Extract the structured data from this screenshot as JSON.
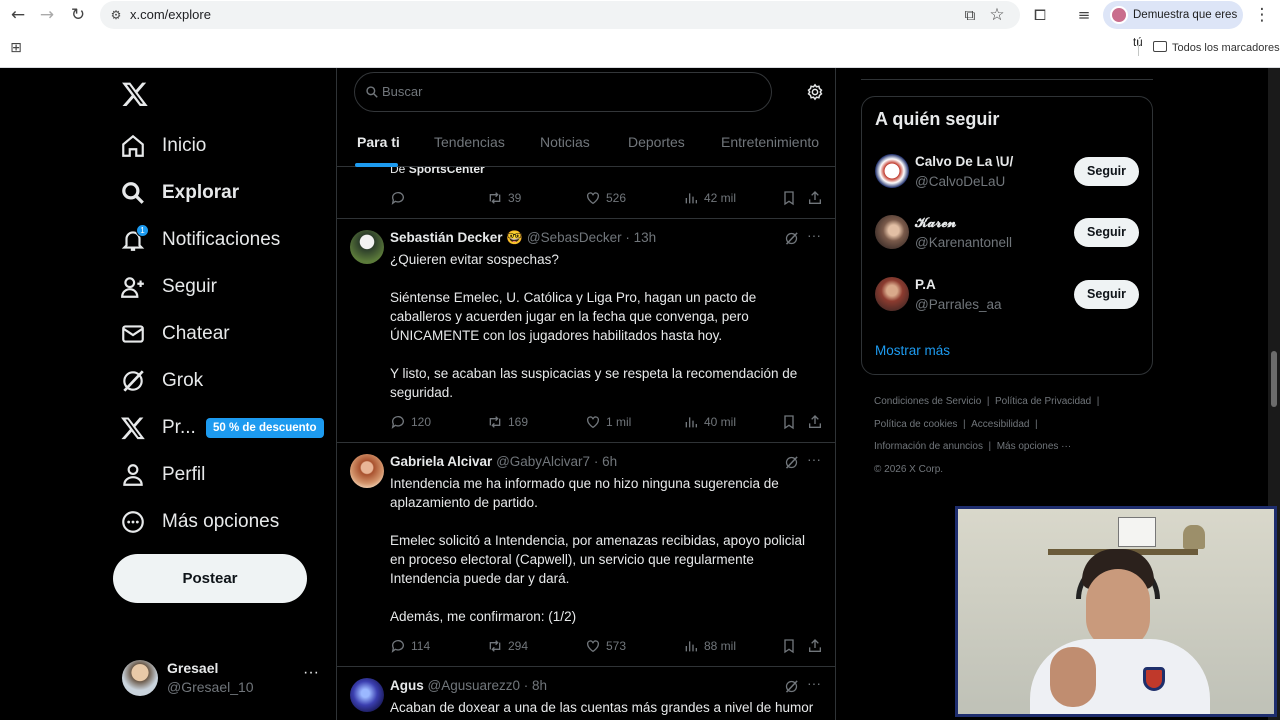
{
  "browser": {
    "url": "x.com/explore",
    "profile_label": "Demuestra que eres tú",
    "bookmarks_label": "Todos los marcadores"
  },
  "sidebar": {
    "items": [
      {
        "label": "Inicio",
        "icon": "home-icon"
      },
      {
        "label": "Explorar",
        "icon": "search-icon",
        "active": true
      },
      {
        "label": "Notificaciones",
        "icon": "bell-icon"
      },
      {
        "label": "Seguir",
        "icon": "add-person-icon"
      },
      {
        "label": "Chatear",
        "icon": "mail-icon"
      },
      {
        "label": "Grok",
        "icon": "grok-icon"
      },
      {
        "label": "Pr...",
        "icon": "x-logo-icon"
      },
      {
        "label": "Perfil",
        "icon": "person-icon"
      },
      {
        "label": "Más opciones",
        "icon": "more-circle-icon"
      }
    ],
    "notif_count": "1",
    "premium_badge": "50 % de descuento",
    "post_button": "Postear",
    "account": {
      "name": "Gresael",
      "handle": "@Gresael_10"
    }
  },
  "main": {
    "search_placeholder": "Buscar",
    "tabs": [
      "Para ti",
      "Tendencias",
      "Noticias",
      "Deportes",
      "Entretenimiento"
    ],
    "partial_tweet": {
      "text_prefix": "De ",
      "text_bold": "SportsCenter",
      "replies": "",
      "reposts": "39",
      "likes": "526",
      "views": "42 mil"
    },
    "tweets": [
      {
        "name": "Sebastián Decker",
        "emoji": "🤓",
        "handle": "@SebasDecker",
        "time": "· 13h",
        "text": "¿Quieren evitar sospechas?\n\nSiéntense Emelec, U. Católica y Liga Pro, hagan un pacto de caballeros y acuerden jugar en la fecha que convenga, pero ÚNICAMENTE con los jugadores habilitados hasta hoy.\n\nY listo, se acaban las suspicacias y se respeta la recomendación de seguridad.",
        "replies": "120",
        "reposts": "169",
        "likes": "1 mil",
        "views": "40 mil"
      },
      {
        "name": "Gabriela Alcivar",
        "emoji": "",
        "handle": "@GabyAlcivar7",
        "time": "· 6h",
        "text": "Intendencia me ha informado que no hizo ninguna sugerencia de aplazamiento de partido.\n\nEmelec solicitó a Intendencia, por amenazas recibidas, apoyo policial en proceso electoral (Capwell), un servicio que regularmente Intendencia puede dar y dará.\n\nAdemás, me confirmaron: (1/2)",
        "replies": "114",
        "reposts": "294",
        "likes": "573",
        "views": "88 mil"
      },
      {
        "name": "Agus",
        "emoji": "",
        "handle": "@Agusuarezz0",
        "time": "· 8h",
        "text": "Acaban de doxear a una de las cuentas más grandes a nivel de humor negro",
        "replies": "",
        "reposts": "",
        "likes": "",
        "views": ""
      }
    ]
  },
  "right": {
    "who_to_follow_title": "A quién seguir",
    "suggestions": [
      {
        "name": "Calvo De La \\U/",
        "handle": "@CalvoDeLaU",
        "button": "Seguir"
      },
      {
        "name": "𝓚𝓪𝓻𝓮𝓷",
        "handle": "@Karenantonell",
        "button": "Seguir"
      },
      {
        "name": "P.A",
        "handle": "@Parrales_aa",
        "button": "Seguir"
      }
    ],
    "show_more": "Mostrar más",
    "footer": {
      "line1a": "Condiciones de Servicio",
      "line1b": "Política de Privacidad",
      "line2a": "Política de cookies",
      "line2b": "Accesibilidad",
      "line3a": "Información de anuncios",
      "line3b": "Más opciones ···",
      "copyright": "© 2026 X Corp."
    }
  },
  "colors": {
    "accent": "#1d9bf0",
    "background": "#000000",
    "text": "#e7e9ea",
    "muted": "#71767b"
  }
}
